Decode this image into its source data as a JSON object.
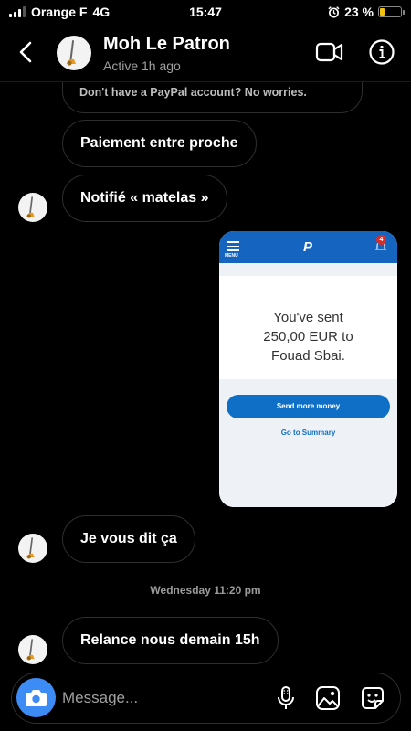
{
  "status_bar": {
    "carrier": "Orange F",
    "network": "4G",
    "time": "15:47",
    "battery": "23 %",
    "battery_level": 0.23,
    "battery_color": "#f2c20f"
  },
  "header": {
    "name": "Moh Le Patron",
    "status": "Active 1h ago",
    "icons": [
      "back-chevron-icon",
      "video-camera-icon",
      "info-icon"
    ]
  },
  "messages": {
    "partial_text": "Don't have a PayPal account? No worries.",
    "m1": "Paiement entre proche",
    "m2": "Notifié « matelas »",
    "m3": "Je vous dit ça",
    "m4": "Relance nous demain 15h"
  },
  "shared_screenshot": {
    "menu_label": "MENU",
    "logo": "P",
    "badge": "4",
    "sent_text": [
      "You've sent",
      "250,00 EUR to",
      "Fouad Sbai."
    ],
    "send_button": "Send more money",
    "summary_link": "Go to Summary",
    "brand_color": "#1565c0"
  },
  "timestamp": "Wednesday 11:20 pm",
  "composer": {
    "placeholder": "Message...",
    "icons": [
      "camera-icon",
      "microphone-icon",
      "gallery-icon",
      "sticker-icon"
    ],
    "camera_color": "#3d8bf5"
  }
}
